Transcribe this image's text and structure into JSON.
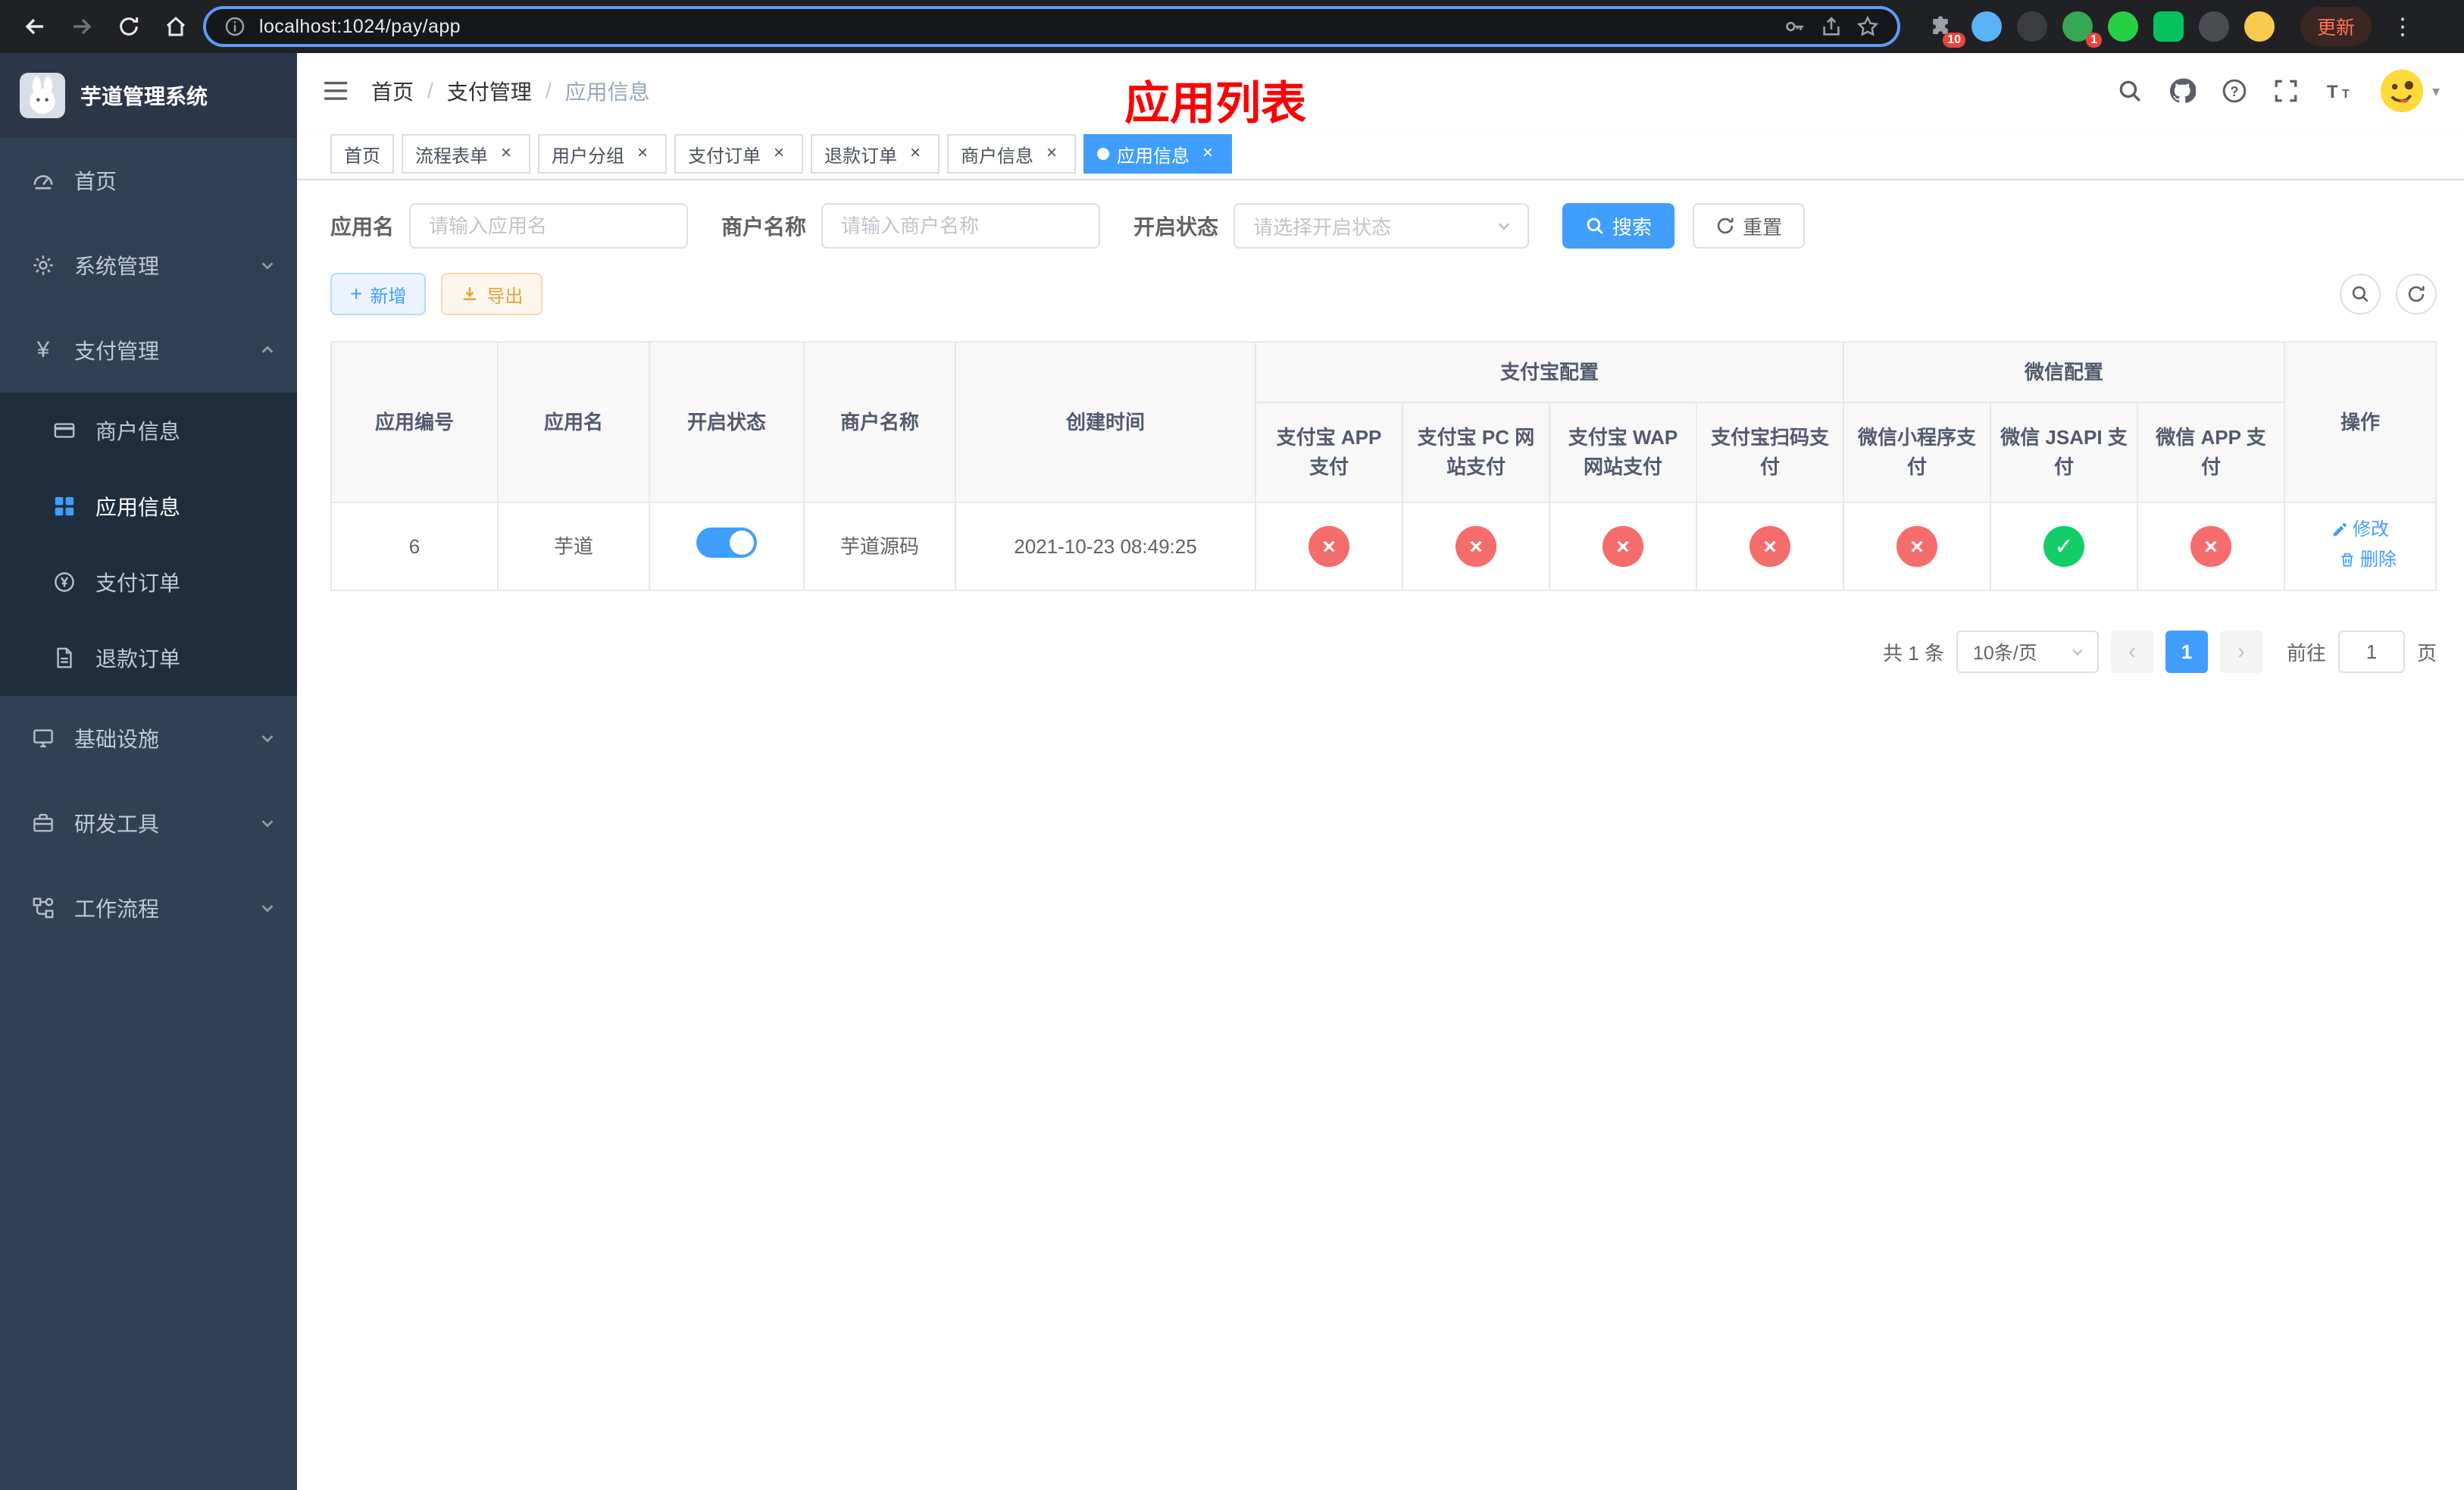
{
  "colors": {
    "accent": "#409eff",
    "danger": "#f56c6c",
    "success": "#13ce66",
    "warning": "#e6a23c",
    "sidebar_bg": "#304156",
    "submenu_bg": "#1f2d3d",
    "title_red": "#ff0000"
  },
  "icons": {
    "tab_close": "×",
    "status_ok": "✓",
    "status_fail": "×",
    "pagination_prev": "‹",
    "pagination_next": "›",
    "add": "+",
    "kebab": "⋮",
    "yen": "¥",
    "caret_down": "▾"
  },
  "browser": {
    "url": "localhost:1024/pay/app",
    "update_label": "更新",
    "extension_badge_puzzle": "10",
    "extension_badge_green": "1"
  },
  "sidebar": {
    "app_title": "芋道管理系统",
    "items": [
      {
        "label": "首页"
      },
      {
        "label": "系统管理"
      },
      {
        "label": "支付管理"
      },
      {
        "label": "基础设施"
      },
      {
        "label": "研发工具"
      },
      {
        "label": "工作流程"
      }
    ],
    "submenu": [
      {
        "label": "商户信息"
      },
      {
        "label": "应用信息"
      },
      {
        "label": "支付订单"
      },
      {
        "label": "退款订单"
      }
    ]
  },
  "navbar": {
    "breadcrumb": [
      {
        "label": "首页"
      },
      {
        "label": "支付管理"
      },
      {
        "label": "应用信息"
      }
    ],
    "separator": "/",
    "page_title": "应用列表"
  },
  "tabs": [
    {
      "label": "首页"
    },
    {
      "label": "流程表单"
    },
    {
      "label": "用户分组"
    },
    {
      "label": "支付订单"
    },
    {
      "label": "退款订单"
    },
    {
      "label": "商户信息"
    },
    {
      "label": "应用信息"
    }
  ],
  "filters": {
    "app_name_label": "应用名",
    "app_name_placeholder": "请输入应用名",
    "merchant_label": "商户名称",
    "merchant_placeholder": "请输入商户名称",
    "status_label": "开启状态",
    "status_placeholder": "请选择开启状态",
    "search_label": "搜索",
    "reset_label": "重置"
  },
  "toolbar": {
    "add_label": "新增",
    "export_label": "导出"
  },
  "table": {
    "headers": {
      "app_id": "应用编号",
      "app_name": "应用名",
      "status": "开启状态",
      "merchant": "商户名称",
      "created": "创建时间",
      "alipay_group": "支付宝配置",
      "wechat_group": "微信配置",
      "alipay_app": "支付宝 APP 支付",
      "alipay_pc": "支付宝 PC 网站支付",
      "alipay_wap": "支付宝 WAP 网站支付",
      "alipay_qr": "支付宝扫码支付",
      "wechat_mini": "微信小程序支付",
      "wechat_jsapi": "微信 JSAPI 支付",
      "wechat_app": "微信 APP 支付",
      "ops": "操作"
    },
    "row": {
      "app_id": "6",
      "app_name": "芋道",
      "enabled": true,
      "merchant": "芋道源码",
      "created": "2021-10-23 08:49:25",
      "configs": [
        false,
        false,
        false,
        false,
        false,
        true,
        false
      ],
      "edit_label": "修改",
      "delete_label": "删除"
    }
  },
  "pagination": {
    "total": "共 1 条",
    "page_size": "10条/页",
    "page": "1",
    "goto_label": "前往",
    "goto_value": "1",
    "unit_label": "页"
  }
}
